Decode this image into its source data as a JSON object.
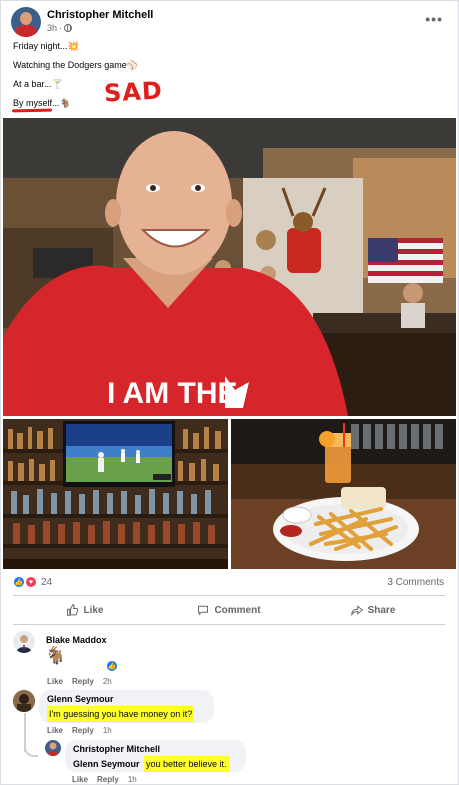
{
  "post": {
    "author": "Christopher Mitchell",
    "time": "3h",
    "lines": [
      "Friday night...",
      "Watching the Dodgers game",
      "At a bar...",
      "By myself..."
    ],
    "emojis": [
      "💥",
      "⚾",
      "🍸",
      "🐐"
    ],
    "annotation": "SAD",
    "shirt_text": "I AM THE"
  },
  "stats": {
    "reaction_count": "24",
    "comments_label": "3 Comments"
  },
  "actions": {
    "like": "Like",
    "comment": "Comment",
    "share": "Share"
  },
  "comments": [
    {
      "author": "Blake Maddox",
      "body": "🐐",
      "like": "Like",
      "reply": "Reply",
      "time": "2h"
    },
    {
      "author": "Glenn Seymour",
      "body": "I'm guessing you have money on it?",
      "like": "Like",
      "reply": "Reply",
      "time": "1h"
    },
    {
      "author": "Christopher Mitchell",
      "mention": "Glenn Seymour",
      "body": "you better believe it.",
      "like": "Like",
      "reply": "Reply",
      "time": "1h"
    }
  ],
  "colors": {
    "accent": "#1877f2",
    "highlight": "#ffff2a",
    "annotation": "#e11d1d"
  }
}
